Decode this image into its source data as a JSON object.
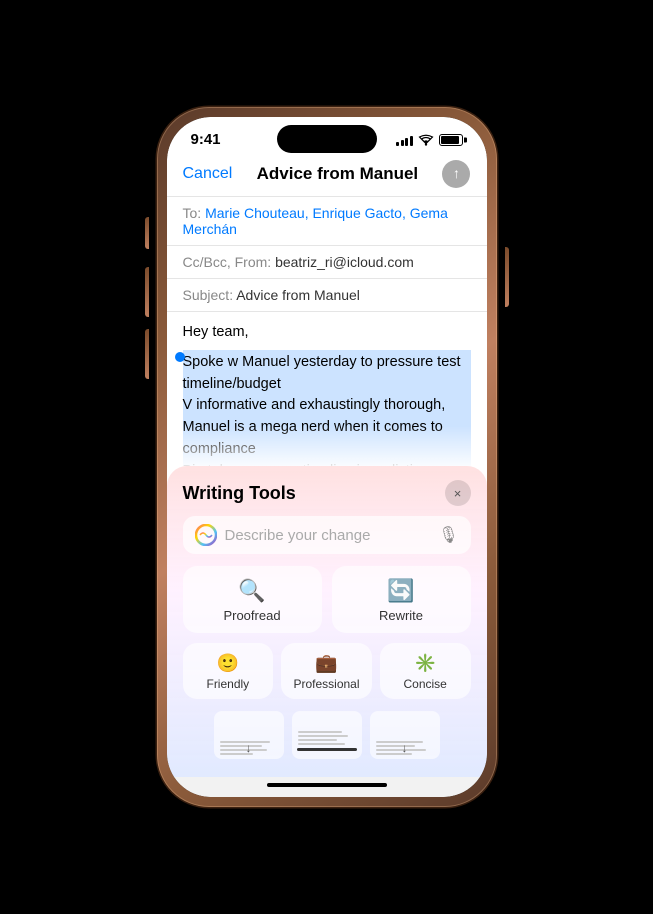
{
  "status_bar": {
    "time": "9:41",
    "signal_bars": [
      4,
      6,
      8,
      10,
      12
    ],
    "wifi": "wifi",
    "battery": "battery"
  },
  "mail": {
    "cancel_label": "Cancel",
    "title": "Advice from Manuel",
    "to_label": "To: ",
    "to_value": "Marie Chouteau, Enrique Gacto, Gema Merchán",
    "cc_label": "Cc/Bcc, From: ",
    "cc_value": "beatriz_ri@icloud.com",
    "subject_label": "Subject: ",
    "subject_value": "Advice from Manuel",
    "greeting": "Hey team,",
    "body_selected": "Spoke w Manuel yesterday to pressure test timeline/budget\nV informative and exhaustingly thorough, Manuel is a mega nerd when it comes to compliance\nBig takeaway was timeline is realistic, we can commit with confidence, woo!\nM's firm specializes in community consultation, we need help here, should consider engaging them from re"
  },
  "writing_tools": {
    "title": "Writing Tools",
    "close_label": "×",
    "search_placeholder": "Describe your change",
    "buttons": {
      "proofread_label": "Proofread",
      "rewrite_label": "Rewrite",
      "friendly_label": "Friendly",
      "professional_label": "Professional",
      "concise_label": "Concise"
    },
    "thumbnails": 3
  }
}
